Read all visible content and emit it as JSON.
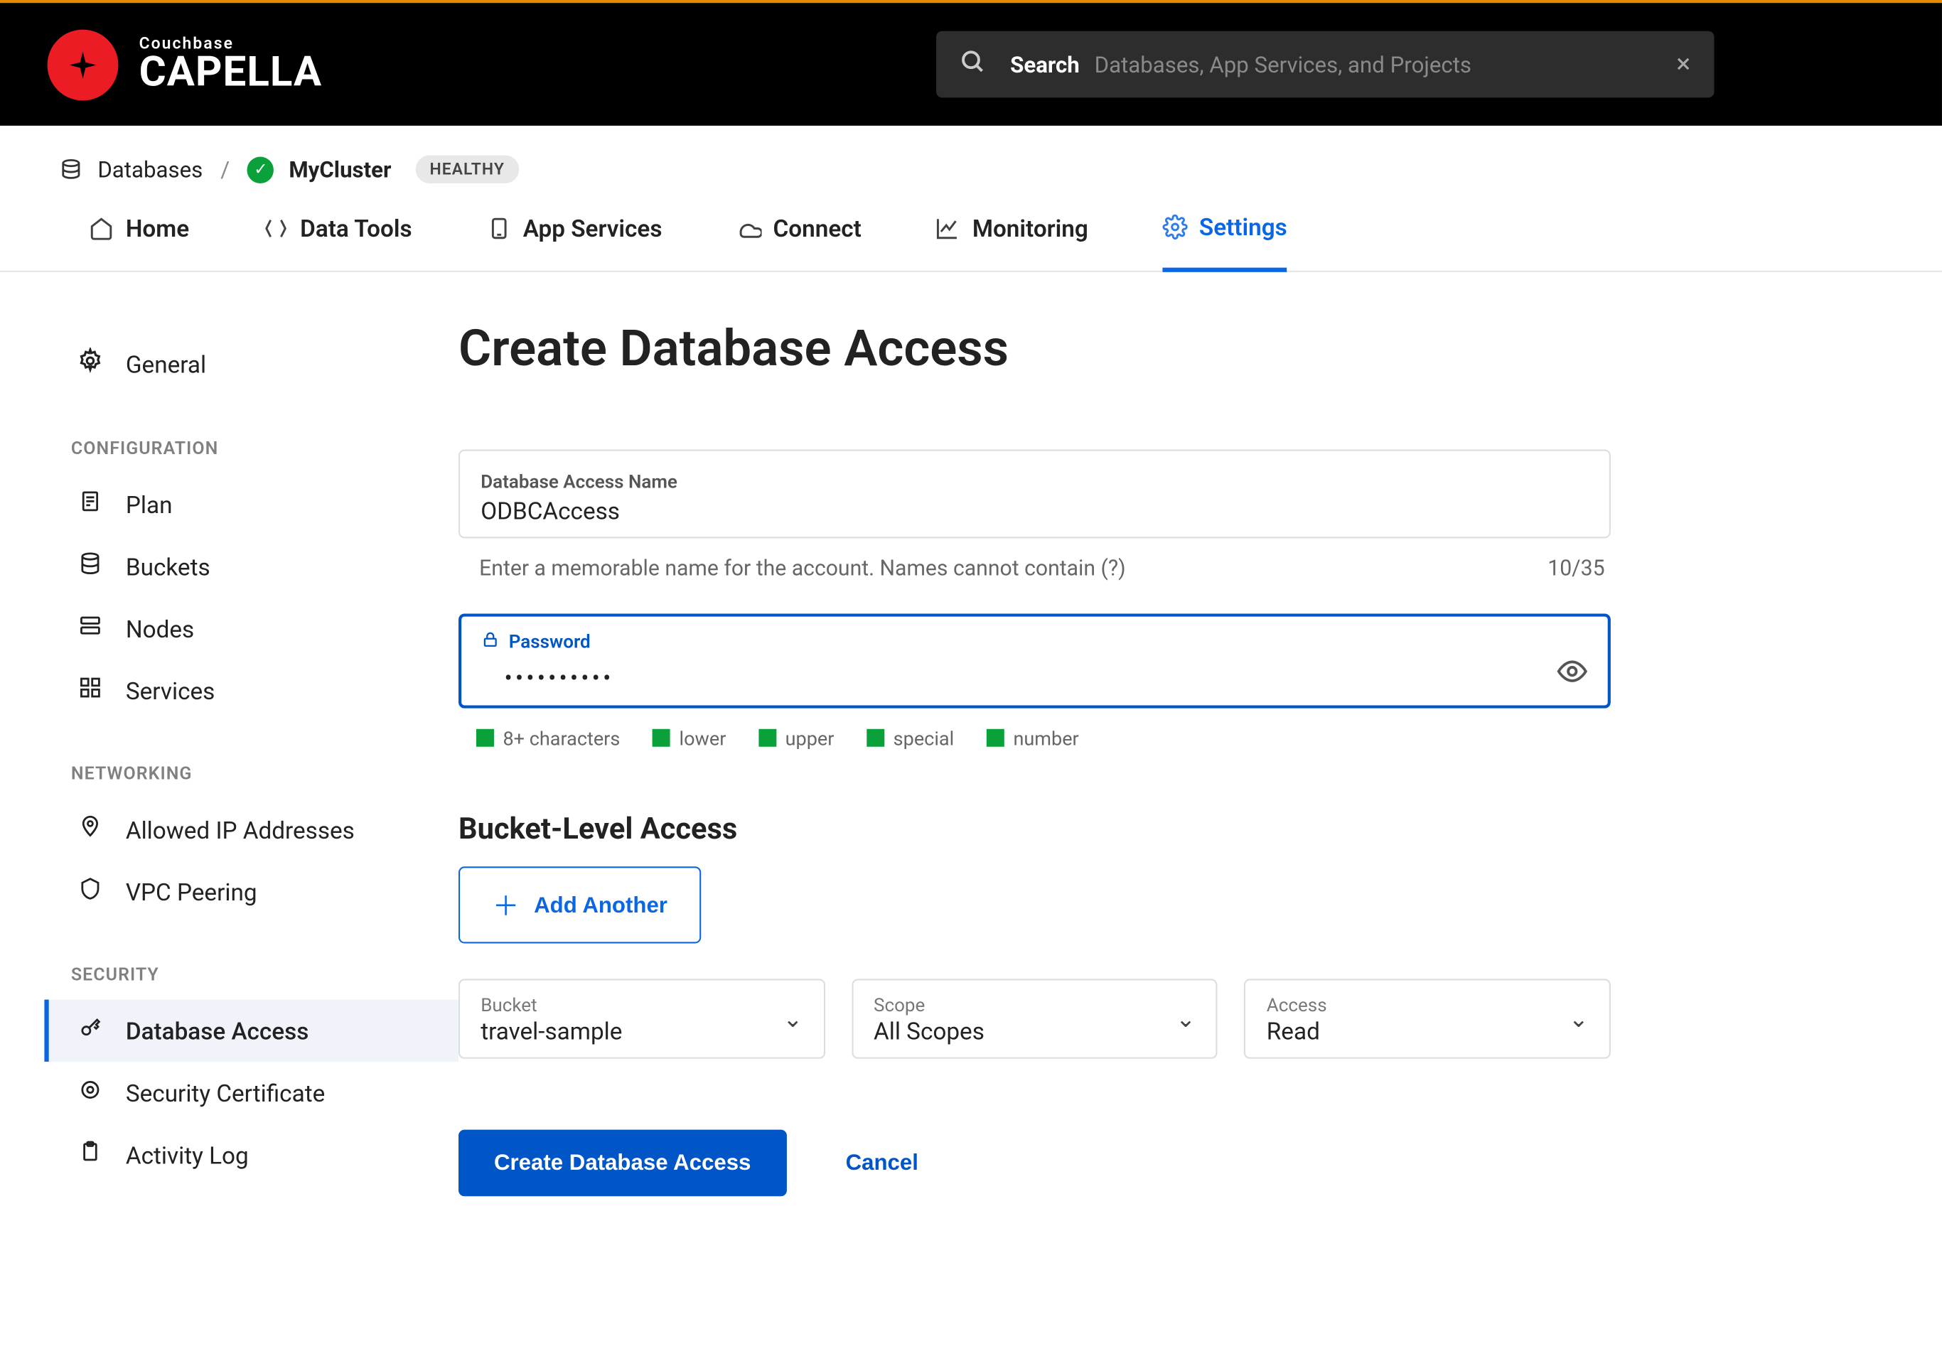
{
  "logo": {
    "brand": "Couchbase",
    "product": "CAPELLA"
  },
  "search": {
    "label": "Search",
    "placeholder": "Databases, App Services, and Projects"
  },
  "breadcrumb": {
    "root": "Databases",
    "cluster": "MyCluster",
    "status": "HEALTHY"
  },
  "tabs": [
    {
      "label": "Home"
    },
    {
      "label": "Data Tools"
    },
    {
      "label": "App Services"
    },
    {
      "label": "Connect"
    },
    {
      "label": "Monitoring"
    },
    {
      "label": "Settings"
    }
  ],
  "sidebar": {
    "top": "General",
    "groups": [
      {
        "header": "CONFIGURATION",
        "items": [
          "Plan",
          "Buckets",
          "Nodes",
          "Services"
        ]
      },
      {
        "header": "NETWORKING",
        "items": [
          "Allowed IP Addresses",
          "VPC Peering"
        ]
      },
      {
        "header": "SECURITY",
        "items": [
          "Database Access",
          "Security Certificate",
          "Activity Log"
        ]
      }
    ],
    "active": "Database Access"
  },
  "page": {
    "title": "Create Database Access",
    "name_field": {
      "label": "Database Access Name",
      "value": "ODBCAccess",
      "help": "Enter a memorable name for the account. Names cannot contain (?)",
      "counter": "10/35"
    },
    "password_field": {
      "label": "Password",
      "value": "••••••••••"
    },
    "pw_rules": [
      "8+ characters",
      "lower",
      "upper",
      "special",
      "number"
    ],
    "bucket_section": {
      "heading": "Bucket-Level Access",
      "add_label": "Add Another",
      "bucket": {
        "label": "Bucket",
        "value": "travel-sample"
      },
      "scope": {
        "label": "Scope",
        "value": "All Scopes"
      },
      "access": {
        "label": "Access",
        "value": "Read"
      }
    },
    "actions": {
      "primary": "Create Database Access",
      "cancel": "Cancel"
    }
  }
}
